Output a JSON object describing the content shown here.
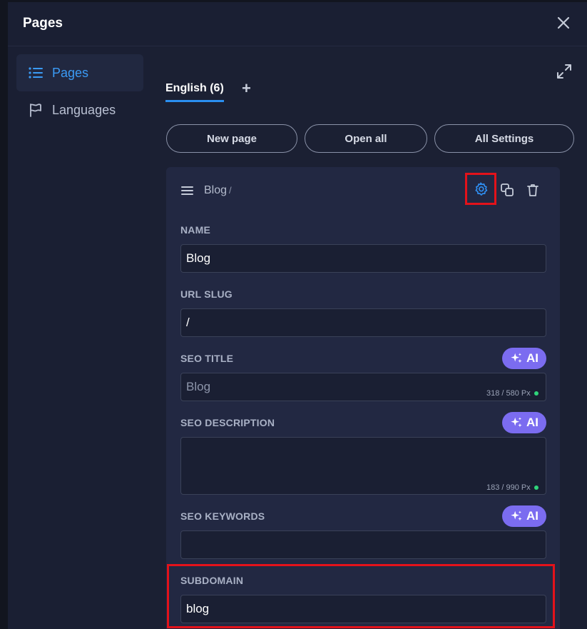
{
  "header": {
    "title": "Pages"
  },
  "sidebar": {
    "items": [
      {
        "label": "Pages",
        "icon": "list-icon",
        "active": true
      },
      {
        "label": "Languages",
        "icon": "flag-icon",
        "active": false
      }
    ]
  },
  "tabs": [
    {
      "label": "English (6)",
      "active": true
    }
  ],
  "tab_add_label": "+",
  "toolbar": {
    "new_page": "New page",
    "open_all": "Open all",
    "all_settings": "All Settings"
  },
  "page_card": {
    "title": "Blog",
    "slug": "/",
    "fields": {
      "name": {
        "label": "NAME",
        "value": "Blog"
      },
      "url_slug": {
        "label": "URL SLUG",
        "value": "/"
      },
      "seo_title": {
        "label": "SEO TITLE",
        "value": "",
        "placeholder": "Blog",
        "counter": "318 / 580 Px",
        "ai_label": "AI"
      },
      "seo_description": {
        "label": "SEO DESCRIPTION",
        "value": "",
        "counter": "183 / 990 Px",
        "ai_label": "AI"
      },
      "seo_keywords": {
        "label": "SEO KEYWORDS",
        "value": "",
        "ai_label": "AI"
      },
      "subdomain": {
        "label": "SUBDOMAIN",
        "value": "blog"
      }
    }
  },
  "colors": {
    "accent": "#2a8ff0",
    "ai_button": "#7b6cf0",
    "highlight": "#e3121a",
    "status_dot": "#2fd47a"
  }
}
